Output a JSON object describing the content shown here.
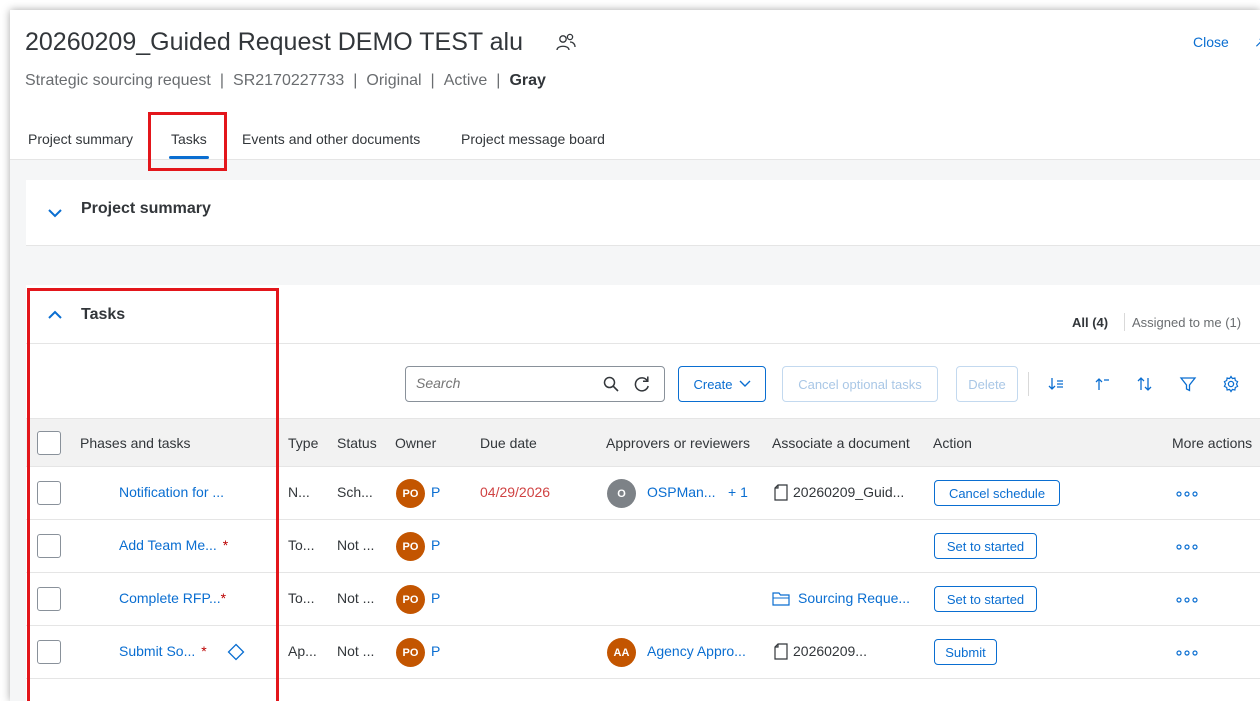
{
  "header": {
    "title": "20260209_Guided Request DEMO TEST alu",
    "close_label": "Close",
    "subtitle": {
      "type": "Strategic sourcing request",
      "id": "SR2170227733",
      "version": "Original",
      "state": "Active",
      "color": "Gray",
      "separator": "|"
    }
  },
  "tabs": [
    {
      "label": "Project summary"
    },
    {
      "label": "Tasks"
    },
    {
      "label": "Events and other documents"
    },
    {
      "label": "Project message board"
    }
  ],
  "project_summary": {
    "title": "Project summary"
  },
  "tasks": {
    "title": "Tasks",
    "filter_all": "All (4)",
    "filter_mine": "Assigned to me (1)",
    "search_placeholder": "Search",
    "create_label": "Create",
    "cancel_optional_label": "Cancel optional tasks",
    "delete_label": "Delete",
    "columns": {
      "phases": "Phases and tasks",
      "type": "Type",
      "status": "Status",
      "owner": "Owner",
      "due": "Due date",
      "approvers": "Approvers or reviewers",
      "document": "Associate a document",
      "action": "Action",
      "more": "More actions"
    },
    "rows": [
      {
        "name": "Notification for ...",
        "required": "",
        "type": "N...",
        "status": "Sch...",
        "owner_initials": "PO",
        "owner_letter": "P",
        "due": "04/29/2026",
        "approver_initials": "O",
        "approver": "OSPMan...",
        "approver_extra": "+ 1",
        "document": "20260209_Guid...",
        "action": "Cancel schedule"
      },
      {
        "name": "Add Team Me...",
        "required": "*",
        "type": "To...",
        "status": "Not ...",
        "owner_initials": "PO",
        "owner_letter": "P",
        "due": "",
        "approver_initials": "",
        "approver": "",
        "approver_extra": "",
        "document": "",
        "action": "Set to started"
      },
      {
        "name": "Complete RFP...",
        "required": "*",
        "type": "To...",
        "status": "Not ...",
        "owner_initials": "PO",
        "owner_letter": "P",
        "due": "",
        "approver_initials": "",
        "approver": "",
        "approver_extra": "",
        "document": "Sourcing Reque...",
        "action": "Set to started"
      },
      {
        "name": "Submit So...",
        "required": "*",
        "type": "Ap...",
        "status": "Not ...",
        "owner_initials": "PO",
        "owner_letter": "P",
        "due": "",
        "approver_initials": "AA",
        "approver": "Agency Appro...",
        "approver_extra": "",
        "document": "20260209...",
        "action": "Submit"
      }
    ]
  },
  "colors": {
    "accent": "#0a6ed1",
    "highlight": "#e3161b",
    "avatar_orange": "#c35500",
    "avatar_gray": "#7d8287",
    "due_date_red": "#d04343"
  },
  "icons": [
    "people-icon",
    "chevron-down-icon",
    "chevron-up-icon",
    "search-icon",
    "refresh-icon",
    "sort-descending-icon",
    "sort-ascending-icon",
    "sort-icon",
    "filter-icon",
    "settings-icon",
    "document-icon",
    "folder-icon",
    "diamond-icon",
    "more-icon"
  ]
}
